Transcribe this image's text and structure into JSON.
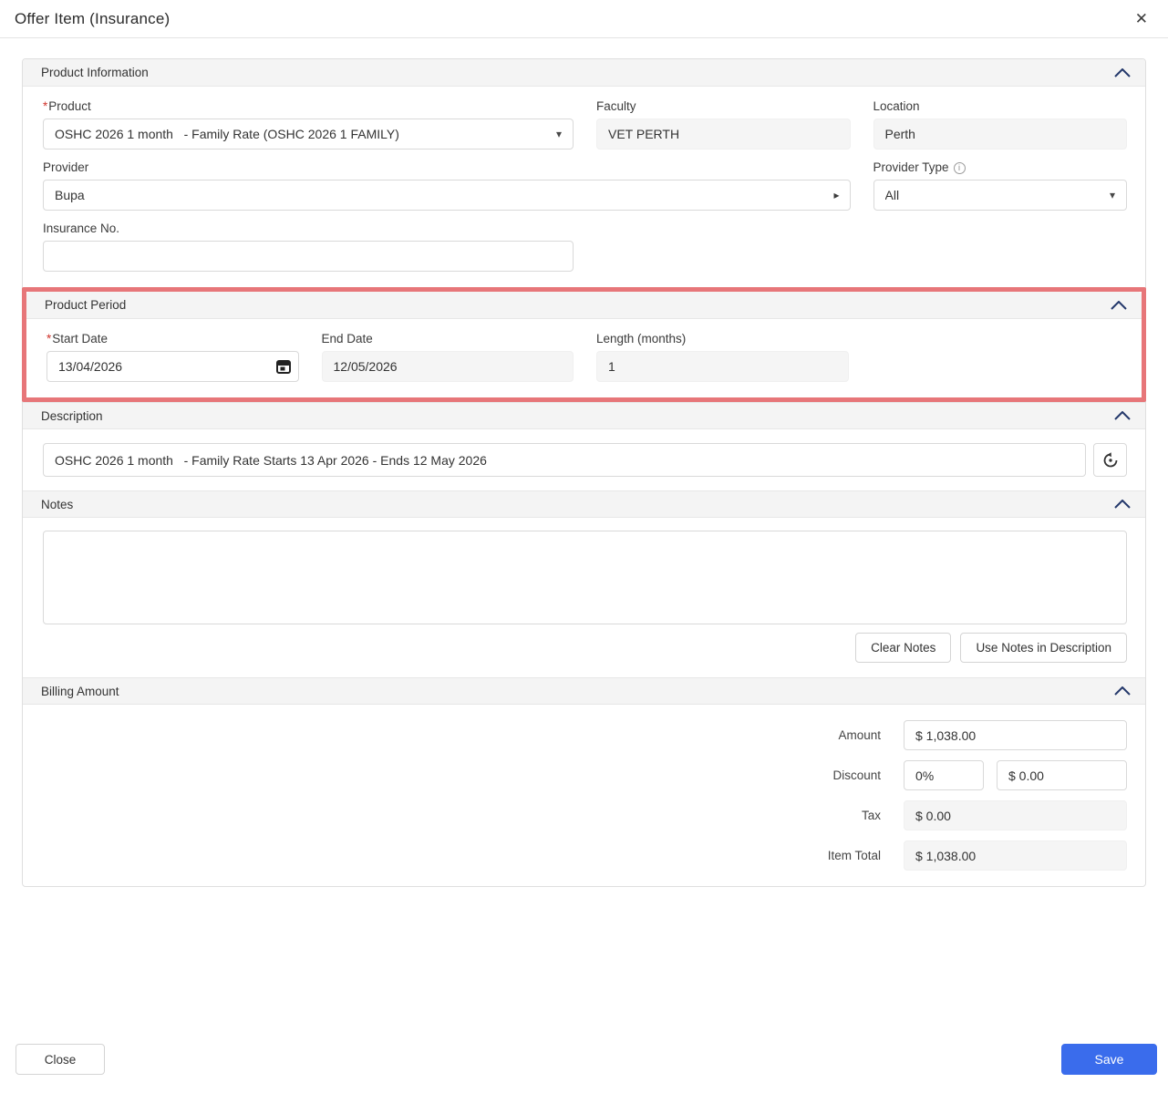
{
  "dialog": {
    "title": "Offer Item (Insurance)"
  },
  "icons": {
    "close": "✕",
    "caret_down": "▾",
    "caret_right": "▸",
    "info": "i"
  },
  "product_information": {
    "title": "Product Information",
    "product_label": "Product",
    "product_value": "OSHC 2026 1 month   - Family Rate (OSHC 2026 1 FAMILY)",
    "faculty_label": "Faculty",
    "faculty_value": "VET PERTH",
    "location_label": "Location",
    "location_value": "Perth",
    "provider_label": "Provider",
    "provider_value": "Bupa",
    "provider_type_label": "Provider Type",
    "provider_type_value": "All",
    "insurance_no_label": "Insurance No.",
    "insurance_no_value": ""
  },
  "product_period": {
    "title": "Product Period",
    "start_date_label": "Start Date",
    "start_date_value": "13/04/2026",
    "end_date_label": "End Date",
    "end_date_value": "12/05/2026",
    "length_label": "Length (months)",
    "length_value": "1"
  },
  "description": {
    "title": "Description",
    "value": "OSHC 2026 1 month   - Family Rate Starts 13 Apr 2026 - Ends 12 May 2026"
  },
  "notes": {
    "title": "Notes",
    "value": "",
    "clear_button": "Clear Notes",
    "use_button": "Use Notes in Description"
  },
  "billing": {
    "title": "Billing Amount",
    "amount_label": "Amount",
    "amount_value": "$ 1,038.00",
    "discount_label": "Discount",
    "discount_percent": "0%",
    "discount_value": "$ 0.00",
    "tax_label": "Tax",
    "tax_value": "$ 0.00",
    "item_total_label": "Item Total",
    "item_total_value": "$ 1,038.00"
  },
  "footer": {
    "close_label": "Close",
    "save_label": "Save"
  },
  "misc": {
    "required_marker": "*"
  },
  "colors": {
    "accent_blue": "#3a6cec",
    "section_chevron": "#24386b",
    "highlight_red": "#e77679",
    "required_red": "#d0342c",
    "readonly_bg": "#f5f5f5"
  }
}
